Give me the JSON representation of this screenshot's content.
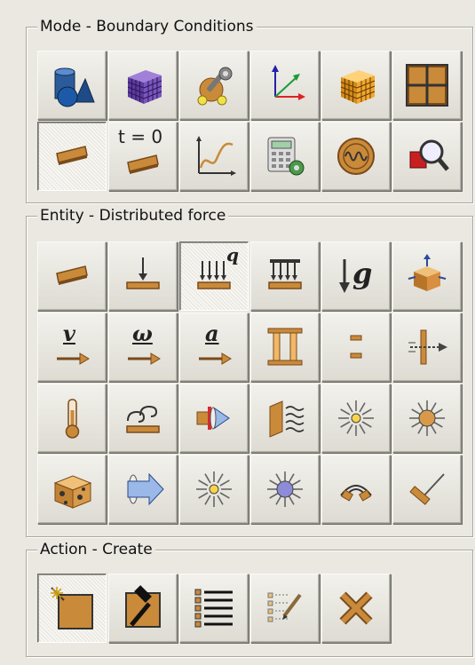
{
  "groups": {
    "mode": {
      "title": "Mode - Boundary Conditions",
      "buttons": [
        {
          "name": "geometry-mode-button",
          "icon": "shapes-icon"
        },
        {
          "name": "mesh-mode-button",
          "icon": "purple-cube-mesh-icon"
        },
        {
          "name": "materials-mode-button",
          "icon": "material-wrench-icon"
        },
        {
          "name": "coordinate-system-button",
          "icon": "axes-icon"
        },
        {
          "name": "solid-mesh-mode-button",
          "icon": "orange-cube-mesh-icon"
        },
        {
          "name": "grid-mode-button",
          "icon": "grid-icon"
        },
        {
          "name": "boundary-conditions-button",
          "icon": "plate-icon",
          "active": true
        },
        {
          "name": "initial-conditions-button",
          "icon": "plate-t0-icon",
          "label": "t = 0"
        },
        {
          "name": "curves-button",
          "icon": "curve-graph-icon"
        },
        {
          "name": "calculator-settings-button",
          "icon": "calculator-gear-icon"
        },
        {
          "name": "oscillator-button",
          "icon": "wave-circle-icon"
        },
        {
          "name": "inspect-button",
          "icon": "magnifier-icon"
        }
      ]
    },
    "entity": {
      "title": "Entity - Distributed force",
      "buttons": [
        {
          "name": "plate-load-button",
          "icon": "plate-icon"
        },
        {
          "name": "point-force-button",
          "icon": "point-force-icon"
        },
        {
          "name": "distributed-force-button",
          "icon": "distributed-force-icon",
          "label": "q",
          "active": true
        },
        {
          "name": "pressure-button",
          "icon": "pressure-icon"
        },
        {
          "name": "gravity-button",
          "icon": "gravity-icon",
          "label": "g"
        },
        {
          "name": "constraint-button",
          "icon": "constraint-block-icon"
        },
        {
          "name": "velocity-button",
          "icon": "velocity-icon",
          "label": "v"
        },
        {
          "name": "angular-velocity-button",
          "icon": "angular-velocity-icon",
          "label": "ω"
        },
        {
          "name": "acceleration-button",
          "icon": "acceleration-icon",
          "label": "a"
        },
        {
          "name": "pillar-button",
          "icon": "pillar-icon"
        },
        {
          "name": "gap-button",
          "icon": "gap-icon"
        },
        {
          "name": "contact-button",
          "icon": "contact-icon"
        },
        {
          "name": "temperature-button",
          "icon": "thermometer-icon"
        },
        {
          "name": "convection-button",
          "icon": "convection-icon"
        },
        {
          "name": "heat-flux-button",
          "icon": "heat-flux-icon"
        },
        {
          "name": "radiation-surface-button",
          "icon": "radiation-surface-icon"
        },
        {
          "name": "point-heat-source-button",
          "icon": "sun-outline-icon"
        },
        {
          "name": "volume-heat-source-button",
          "icon": "sun-filled-icon"
        },
        {
          "name": "cheese-block-button",
          "icon": "cheese-block-icon"
        },
        {
          "name": "surface-flow-button",
          "icon": "flow-arrow-icon"
        },
        {
          "name": "point-source-button",
          "icon": "star-burst-icon"
        },
        {
          "name": "sphere-source-button",
          "icon": "sphere-burst-icon"
        },
        {
          "name": "antenna-button",
          "icon": "antenna-icon"
        },
        {
          "name": "probe-button",
          "icon": "probe-icon"
        }
      ]
    },
    "action": {
      "title": "Action - Create",
      "buttons": [
        {
          "name": "create-button",
          "icon": "create-sparkle-icon",
          "active": true
        },
        {
          "name": "modify-button",
          "icon": "hammer-icon"
        },
        {
          "name": "list-button",
          "icon": "list-icon"
        },
        {
          "name": "edit-list-button",
          "icon": "pencil-list-icon"
        },
        {
          "name": "delete-button",
          "icon": "delete-x-icon"
        }
      ]
    }
  }
}
